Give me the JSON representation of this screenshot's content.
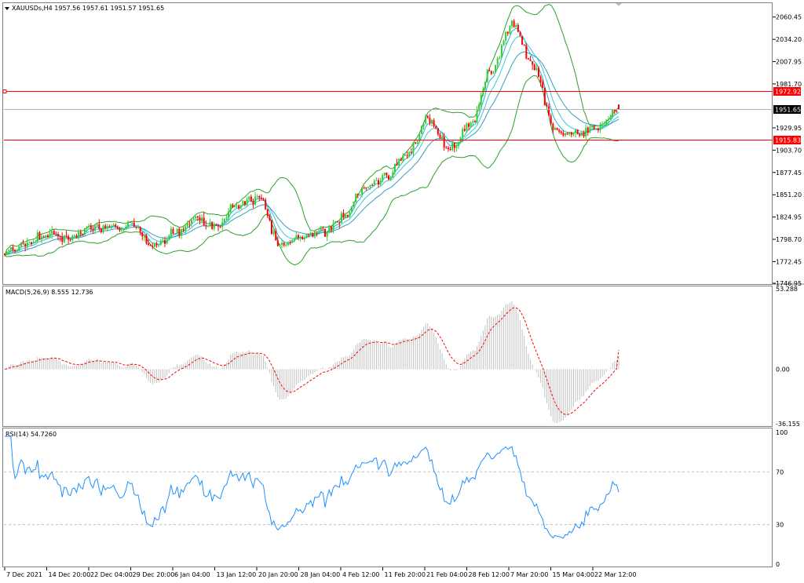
{
  "header": {
    "symbol_line": "XAUUSDs,H4  1957.56 1957.61 1951.57 1951.65"
  },
  "main_panel": {
    "price_ticks": [
      "2060.45",
      "2034.20",
      "2007.95",
      "1981.70",
      "1929.95",
      "1903.70",
      "1877.45",
      "1851.20",
      "1824.95",
      "1798.70",
      "1772.45",
      "1746.95"
    ],
    "ymin": 1746.95,
    "ymax": 2075,
    "levels": [
      {
        "value": 1972.92,
        "label": "1972.92",
        "color": "#ff0000"
      },
      {
        "value": 1915.83,
        "label": "1915.83",
        "color": "#ff0000"
      }
    ],
    "current_price": {
      "value": 1951.65,
      "label": "1951.65"
    },
    "colors": {
      "bull": "#32cd32",
      "bear": "#ff0000",
      "bands": "#2ca02c",
      "ma": "#30c0d8",
      "tag_text": "#ffffff",
      "current_tag": "#000000"
    }
  },
  "macd_panel": {
    "label": "MACD(5,26,9) 8.555 12.736",
    "ticks": [
      "53.288",
      "0.00",
      "-36.155"
    ],
    "ymin": -36.155,
    "ymax": 53.288,
    "colors": {
      "hist": "#c0c0c0",
      "signal": "#ff0000"
    }
  },
  "rsi_panel": {
    "label": "RSI(14) 54.7260",
    "ticks": [
      "100",
      "70",
      "30",
      "0"
    ],
    "levels": [
      70,
      30
    ],
    "color": "#1e90ff"
  },
  "time_axis": {
    "labels": [
      "7 Dec 2021",
      "14 Dec 20:00",
      "22 Dec 04:00",
      "29 Dec 20:00",
      "6 Jan 04:00",
      "13 Jan 12:00",
      "20 Jan 20:00",
      "28 Jan 04:00",
      "4 Feb 12:00",
      "11 Feb 20:00",
      "21 Feb 04:00",
      "28 Feb 12:00",
      "7 Mar 20:00",
      "15 Mar 04:00",
      "22 Mar 12:00"
    ]
  },
  "chart_data": {
    "type": "candlestick",
    "symbol": "XAUUSDs",
    "timeframe": "H4",
    "last": {
      "open": 1957.56,
      "high": 1957.61,
      "low": 1951.57,
      "close": 1951.65
    },
    "close_path": [
      [
        "7 Dec 2021",
        1782
      ],
      [
        "14 Dec 20:00",
        1792
      ],
      [
        "17 Dec",
        1805
      ],
      [
        "22 Dec 04:00",
        1799
      ],
      [
        "27 Dec",
        1812
      ],
      [
        "29 Dec 20:00",
        1811
      ],
      [
        "3 Jan",
        1815
      ],
      [
        "6 Jan 04:00",
        1790
      ],
      [
        "10 Jan",
        1805
      ],
      [
        "13 Jan 12:00",
        1822
      ],
      [
        "18 Jan",
        1815
      ],
      [
        "20 Jan 20:00",
        1840
      ],
      [
        "25 Jan",
        1848
      ],
      [
        "28 Jan 04:00",
        1790
      ],
      [
        "1 Feb",
        1802
      ],
      [
        "4 Feb 12:00",
        1808
      ],
      [
        "8 Feb",
        1826
      ],
      [
        "11 Feb 20:00",
        1858
      ],
      [
        "16 Feb",
        1870
      ],
      [
        "21 Feb 04:00",
        1900
      ],
      [
        "24 Feb",
        1940
      ],
      [
        "28 Feb 12:00",
        1905
      ],
      [
        "3 Mar",
        1935
      ],
      [
        "7 Mar 20:00",
        2000
      ],
      [
        "8 Mar",
        2055
      ],
      [
        "10 Mar",
        2000
      ],
      [
        "15 Mar 04:00",
        1925
      ],
      [
        "18 Mar",
        1925
      ],
      [
        "22 Mar 12:00",
        1930
      ],
      [
        "25 Mar",
        1955
      ]
    ],
    "macd": {
      "fast": 5,
      "slow": 26,
      "signal": 9,
      "main_last": 8.555,
      "signal_last": 12.736,
      "range": [
        -36.155,
        53.288
      ]
    },
    "rsi": {
      "period": 14,
      "last": 54.726,
      "levels": [
        30,
        70
      ],
      "range": [
        0,
        100
      ]
    },
    "horizontal_lines": [
      1972.92,
      1915.83
    ]
  }
}
